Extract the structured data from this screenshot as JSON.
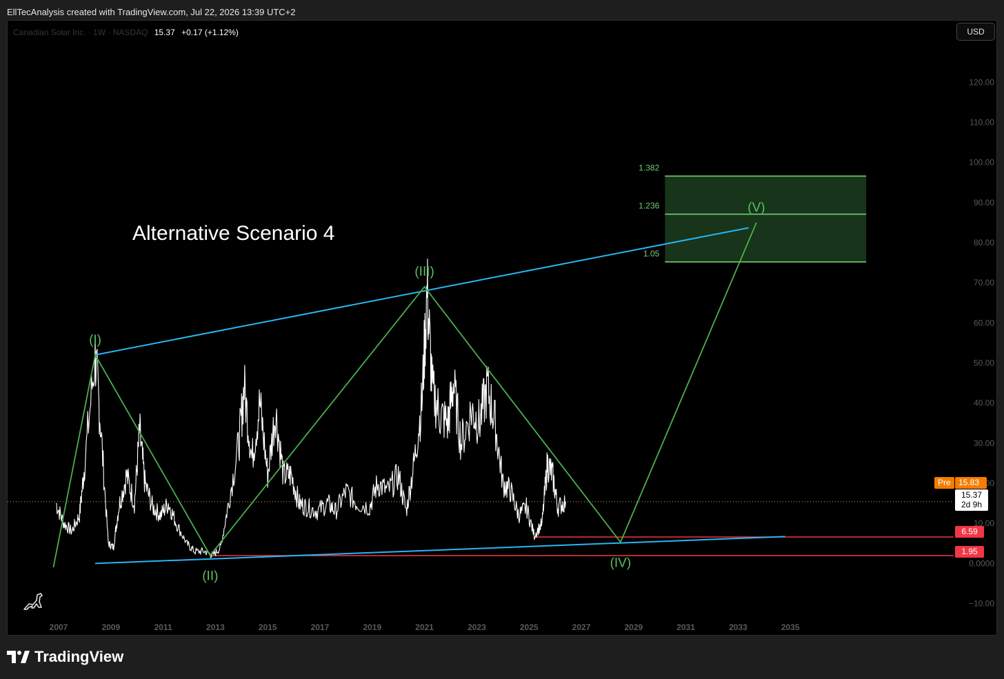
{
  "header": {
    "text": "EllTecAnalysis created with TradingView.com, Jul 22, 2026 13:39 UTC+2"
  },
  "legend": {
    "symbol": "Canadian Solar Inc. · 1W · NASDAQ",
    "price": "15.37",
    "change": "+0.17 (+1.12%)"
  },
  "currency_button": "USD",
  "annotation": "Alternative Scenario 4",
  "price_tags": {
    "pre_label": "Pre",
    "pre_value": "15.83",
    "last_value": "15.37",
    "countdown": "2d 9h",
    "support_high": "6.59",
    "support_low": "1.95"
  },
  "footer": {
    "brand": "TradingView"
  },
  "colors": {
    "background": "#000000",
    "price": "#ffffff",
    "wave": "#4caf50",
    "trendline": "#29b6f6",
    "support": "#f23645",
    "fib_zone": "#1b3a1d",
    "pre_tag": "#f57c00"
  },
  "chart_data": {
    "type": "line",
    "x_axis": {
      "unit": "year",
      "tick_labels": [
        "2007",
        "2009",
        "2011",
        "2013",
        "2015",
        "2017",
        "2019",
        "2021",
        "2023",
        "2025",
        "2027",
        "2029",
        "2031",
        "2033",
        "2035"
      ]
    },
    "y_axis": {
      "tick_labels": [
        "120.00",
        "110.00",
        "100.00",
        "90.00",
        "80.00",
        "70.00",
        "60.00",
        "50.00",
        "40.00",
        "30.00",
        "20.00",
        "10.00",
        "0.0000",
        "−10.00"
      ],
      "range": [
        -12,
        124
      ]
    },
    "series": [
      {
        "style": "white price line",
        "points": [
          [
            2006.9,
            15
          ],
          [
            2007.2,
            10
          ],
          [
            2007.5,
            8
          ],
          [
            2007.8,
            12
          ],
          [
            2008.0,
            25
          ],
          [
            2008.4,
            52
          ],
          [
            2008.6,
            35
          ],
          [
            2008.9,
            5
          ],
          [
            2009.1,
            4
          ],
          [
            2009.3,
            14
          ],
          [
            2009.6,
            22
          ],
          [
            2009.9,
            15
          ],
          [
            2010.1,
            33
          ],
          [
            2010.3,
            20
          ],
          [
            2010.6,
            14
          ],
          [
            2010.9,
            12
          ],
          [
            2011.2,
            15
          ],
          [
            2011.5,
            10
          ],
          [
            2011.9,
            5
          ],
          [
            2012.2,
            3
          ],
          [
            2012.6,
            3
          ],
          [
            2012.9,
            2
          ],
          [
            2013.2,
            4
          ],
          [
            2013.5,
            15
          ],
          [
            2013.9,
            30
          ],
          [
            2014.1,
            44
          ],
          [
            2014.4,
            26
          ],
          [
            2014.7,
            40
          ],
          [
            2015.0,
            22
          ],
          [
            2015.3,
            38
          ],
          [
            2015.6,
            22
          ],
          [
            2015.9,
            22
          ],
          [
            2016.2,
            15
          ],
          [
            2016.5,
            14
          ],
          [
            2016.9,
            13
          ],
          [
            2017.3,
            15
          ],
          [
            2017.6,
            13
          ],
          [
            2018.0,
            18
          ],
          [
            2018.4,
            15
          ],
          [
            2018.9,
            14
          ],
          [
            2019.2,
            20
          ],
          [
            2019.6,
            18
          ],
          [
            2020.0,
            22
          ],
          [
            2020.3,
            13
          ],
          [
            2020.6,
            25
          ],
          [
            2020.9,
            40
          ],
          [
            2021.1,
            68
          ],
          [
            2021.3,
            43
          ],
          [
            2021.6,
            37
          ],
          [
            2021.9,
            35
          ],
          [
            2022.1,
            45
          ],
          [
            2022.4,
            30
          ],
          [
            2022.8,
            38
          ],
          [
            2023.1,
            35
          ],
          [
            2023.4,
            44
          ],
          [
            2023.7,
            35
          ],
          [
            2024.0,
            20
          ],
          [
            2024.3,
            18
          ],
          [
            2024.6,
            12
          ],
          [
            2024.9,
            14
          ],
          [
            2025.2,
            7
          ],
          [
            2025.5,
            10
          ],
          [
            2025.7,
            25
          ],
          [
            2025.9,
            22
          ],
          [
            2026.1,
            14
          ],
          [
            2026.4,
            15.4
          ]
        ]
      },
      {
        "name": "",
        "style": "green Elliott wave path",
        "points": [
          [
            2006.8,
            -1
          ],
          [
            2008.4,
            52
          ],
          [
            2012.8,
            2
          ],
          [
            2021.0,
            69
          ],
          [
            2028.5,
            5.3
          ],
          [
            2033.7,
            85
          ]
        ]
      }
    ],
    "trendlines": [
      {
        "style": "blue upper",
        "from": [
          2008.4,
          52
        ],
        "to": [
          2033.4,
          83.7
        ]
      },
      {
        "style": "blue lower",
        "from": [
          2008.4,
          0
        ],
        "to": [
          2034.8,
          6.7
        ]
      }
    ],
    "horizontal_levels": [
      {
        "label": "6.59",
        "value": 6.59,
        "x_start": 2025.2
      },
      {
        "label": "1.95",
        "value": 1.95,
        "x_start": 2012.8
      },
      {
        "label": "current",
        "value": 15.37,
        "style": "dotted orange"
      }
    ],
    "fib_extension": {
      "x_start": 2030.2,
      "x_end": 2037.9,
      "levels": [
        {
          "label": "1.382",
          "value": 96.6
        },
        {
          "label": "1.236",
          "value": 87.1
        },
        {
          "label": "1.05",
          "value": 75.2
        }
      ]
    },
    "wave_labels": [
      {
        "label": "(I)",
        "x": 2008.4,
        "y": 52
      },
      {
        "label": "(II)",
        "x": 2012.8,
        "y": 2
      },
      {
        "label": "(III)",
        "x": 2021.0,
        "y": 69
      },
      {
        "label": "(IV)",
        "x": 2028.5,
        "y": 5.3
      },
      {
        "label": "(V)",
        "x": 2033.7,
        "y": 85
      }
    ]
  }
}
